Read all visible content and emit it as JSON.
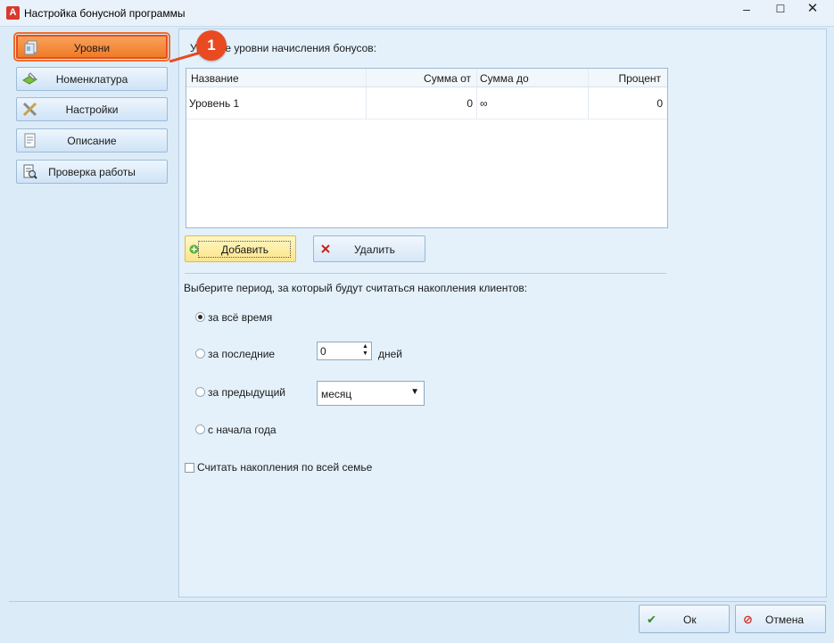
{
  "window": {
    "title": "Настройка бонусной программы",
    "minimize": "–",
    "maximize": "☐",
    "close": "✕"
  },
  "annotation_badge": "1",
  "sidebar": {
    "items": [
      {
        "label": "Уровни",
        "icon": "levels-icon",
        "active": true
      },
      {
        "label": "Номенклатура",
        "icon": "nomenclature-icon",
        "active": false
      },
      {
        "label": "Настройки",
        "icon": "settings-icon",
        "active": false
      },
      {
        "label": "Описание",
        "icon": "description-icon",
        "active": false
      },
      {
        "label": "Проверка работы",
        "icon": "check-work-icon",
        "active": false
      }
    ]
  },
  "levels": {
    "heading": "Укажите уровни начисления бонусов:",
    "columns": [
      "Название",
      "Сумма от",
      "Сумма до",
      "Процент"
    ],
    "rows": [
      {
        "name": "Уровень 1",
        "from": "0",
        "to": "∞",
        "percent": "0"
      }
    ],
    "add_label": "Добавить",
    "delete_label": "Удалить"
  },
  "period": {
    "heading": "Выберите период, за который будут считаться накопления клиентов:",
    "options": [
      {
        "label": "за всё время",
        "selected": true
      },
      {
        "label": "за последние",
        "selected": false
      },
      {
        "label": "за предыдущий",
        "selected": false
      },
      {
        "label": "с начала года",
        "selected": false
      }
    ],
    "last_value": "0",
    "days_label": "дней",
    "previous_value": "месяц"
  },
  "family": {
    "label": "Считать накопления по всей семье",
    "checked": false
  },
  "footer": {
    "ok_label": "Ок",
    "cancel_label": "Отмена"
  },
  "colors": {
    "active_tab": "#ef7a27",
    "highlight_border": "#e84e1c",
    "panel_bg": "#e4f1fb",
    "add_button": "#fbe58a"
  }
}
